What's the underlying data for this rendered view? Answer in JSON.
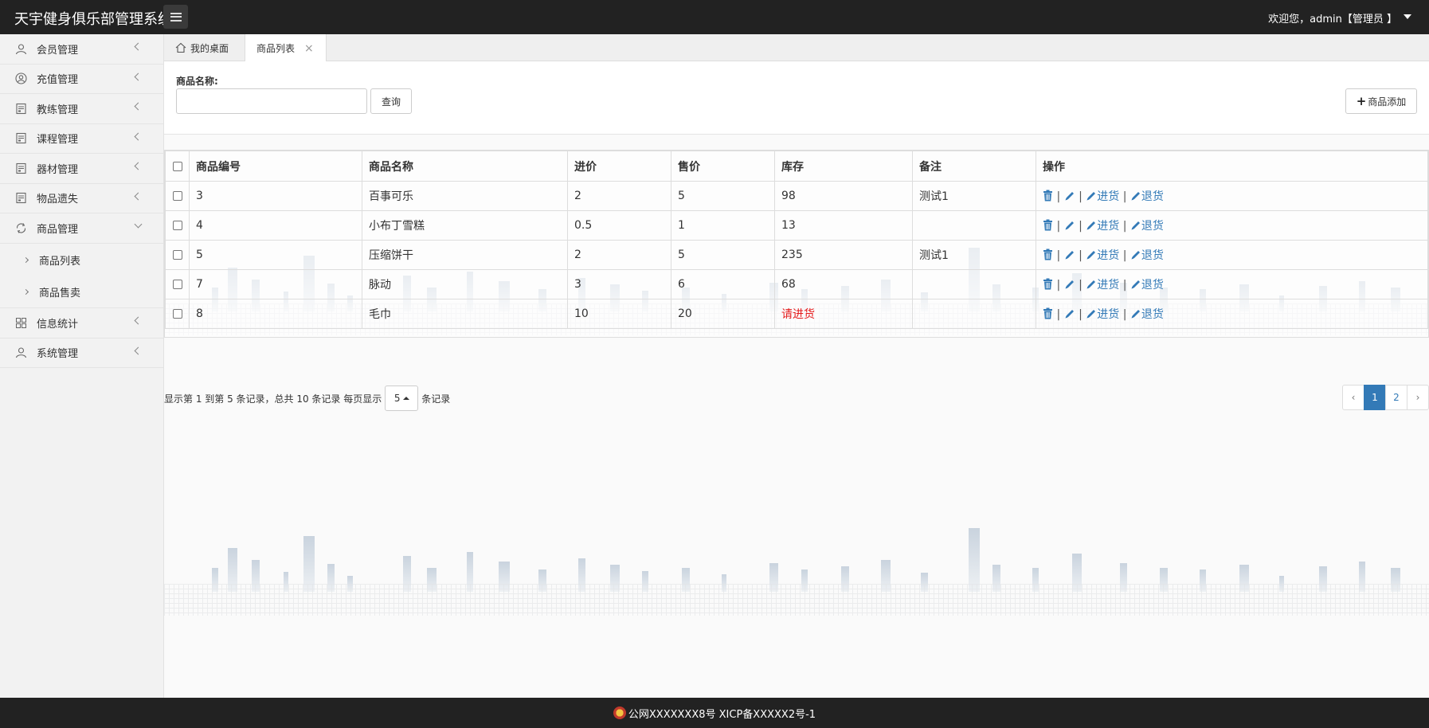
{
  "header": {
    "app_title": "天宇健身俱乐部管理系统",
    "welcome": "欢迎您，admin【管理员 】"
  },
  "sidebar": {
    "items": [
      {
        "label": "会员管理",
        "icon": "user-icon"
      },
      {
        "label": "充值管理",
        "icon": "user-circle-icon"
      },
      {
        "label": "教练管理",
        "icon": "document-icon"
      },
      {
        "label": "课程管理",
        "icon": "document-icon"
      },
      {
        "label": "器材管理",
        "icon": "document-icon"
      },
      {
        "label": "物品遗失",
        "icon": "document-icon"
      },
      {
        "label": "商品管理",
        "icon": "refresh-icon"
      },
      {
        "label": "信息统计",
        "icon": "grid-icon"
      },
      {
        "label": "系统管理",
        "icon": "user-icon"
      }
    ],
    "sub_items": [
      "商品列表",
      "商品售卖"
    ]
  },
  "tabs": {
    "home": "我的桌面",
    "active": "商品列表",
    "close": "×"
  },
  "search": {
    "label": "商品名称:",
    "value": "",
    "query_button": "查询",
    "add_button": "商品添加"
  },
  "table": {
    "headers": [
      "商品编号",
      "商品名称",
      "进价",
      "售价",
      "库存",
      "备注",
      "操作"
    ],
    "rows": [
      {
        "id": "3",
        "name": "百事可乐",
        "cost": "2",
        "price": "5",
        "stock": "98",
        "note": "测试1"
      },
      {
        "id": "4",
        "name": "小布丁雪糕",
        "cost": "0.5",
        "price": "1",
        "stock": "13",
        "note": ""
      },
      {
        "id": "5",
        "name": "压缩饼干",
        "cost": "2",
        "price": "5",
        "stock": "235",
        "note": "测试1"
      },
      {
        "id": "7",
        "name": "脉动",
        "cost": "3",
        "price": "6",
        "stock": "68",
        "note": ""
      },
      {
        "id": "8",
        "name": "毛巾",
        "cost": "10",
        "price": "20",
        "stock": "请进货",
        "note": ""
      }
    ],
    "op_restock": "进货",
    "op_return": "退货",
    "separator": "|"
  },
  "pagination": {
    "info_prefix": "显示第 1 到第 5 条记录，总共 10 条记录 每页显示",
    "page_size": "5",
    "info_suffix": "条记录",
    "prev": "‹",
    "pages": [
      "1",
      "2"
    ],
    "next": "›"
  },
  "footer": {
    "text": "公网XXXXXXX8号 XICP备XXXXX2号-1"
  },
  "colors": {
    "header_bg": "#222222",
    "link": "#337ab7",
    "warning": "#e4191a"
  }
}
